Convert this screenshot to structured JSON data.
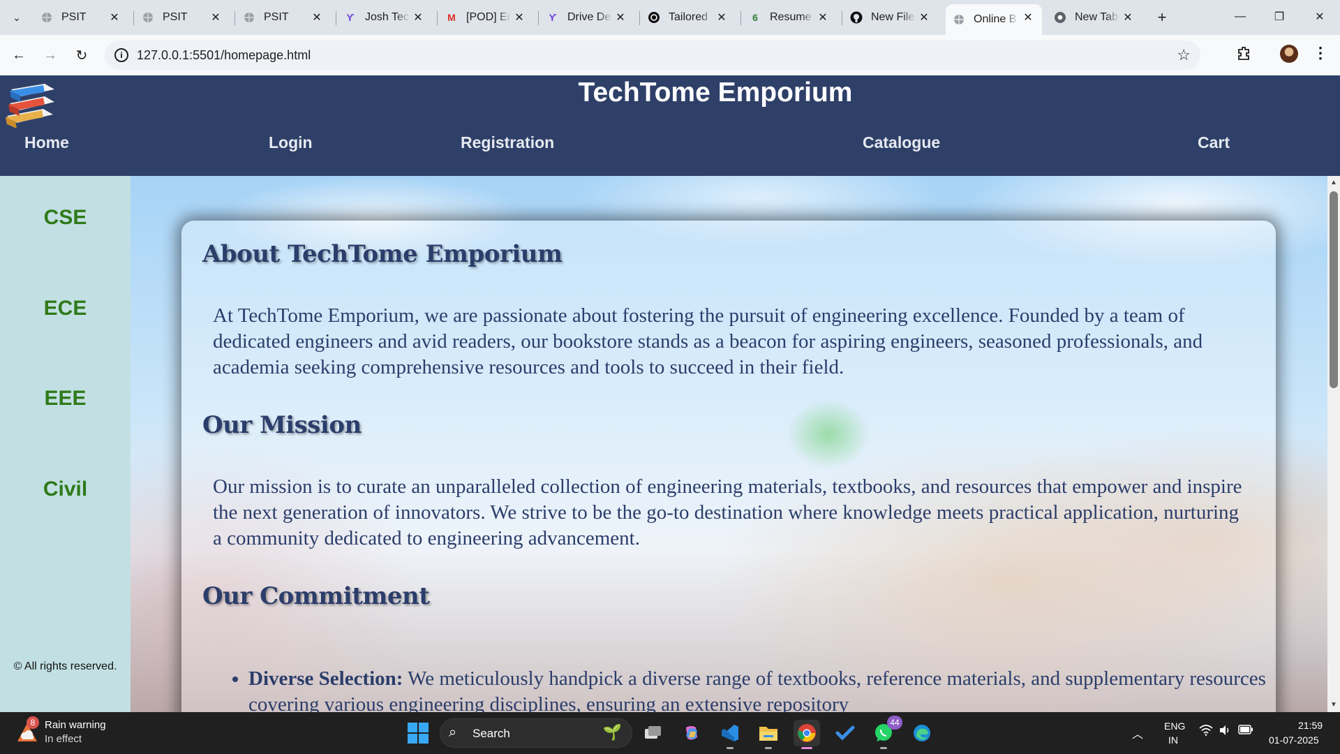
{
  "browser": {
    "tabs": [
      {
        "title": "PSIT",
        "favicon": "globe-icon"
      },
      {
        "title": "PSIT",
        "favicon": "globe-icon"
      },
      {
        "title": "PSIT",
        "favicon": "globe-icon"
      },
      {
        "title": "Josh Tec",
        "favicon": "josh-icon"
      },
      {
        "title": "[POD] Er",
        "favicon": "gmail-icon"
      },
      {
        "title": "Drive De",
        "favicon": "drive-icon"
      },
      {
        "title": "Tailored",
        "favicon": "openai-icon"
      },
      {
        "title": "Resume",
        "favicon": "resume-icon"
      },
      {
        "title": "New File",
        "favicon": "github-icon"
      },
      {
        "title": "Online B",
        "favicon": "globe-icon",
        "active": true
      },
      {
        "title": "New Tab",
        "favicon": "chrome-icon"
      }
    ],
    "url": "127.0.0.1:5501/homepage.html"
  },
  "site": {
    "title": "TechTome Emporium",
    "nav": [
      "Home",
      "Login",
      "Registration",
      "Catalogue",
      "Cart"
    ],
    "sidebar": [
      "CSE",
      "ECE",
      "EEE",
      "Civil"
    ],
    "copyright": "© All rights reserved."
  },
  "content": {
    "about_heading": "About TechTome Emporium",
    "about_text": "At TechTome Emporium, we are passionate about fostering the pursuit of engineering excellence. Founded by a team of dedicated engineers and avid readers, our bookstore stands as a beacon for aspiring engineers, seasoned professionals, and academia seeking comprehensive resources and tools to succeed in their field.",
    "mission_heading": "Our Mission",
    "mission_text": "Our mission is to curate an unparalleled collection of engineering materials, textbooks, and resources that empower and inspire the next generation of innovators. We strive to be the go-to destination where knowledge meets practical application, nurturing a community dedicated to engineering advancement.",
    "commitment_heading": "Our Commitment",
    "commitment_items": [
      {
        "label": "Diverse Selection:",
        "text": " We meticulously handpick a diverse range of textbooks, reference materials, and supplementary resources covering various engineering disciplines, ensuring an extensive repository"
      }
    ]
  },
  "taskbar": {
    "weather_badge": "8",
    "weather_title": "Rain warning",
    "weather_status": "In effect",
    "search_label": "Search",
    "whatsapp_badge": "44",
    "lang_line1": "ENG",
    "lang_line2": "IN",
    "time": "21:59",
    "date": "01-07-2025"
  },
  "colors": {
    "header_bg": "#2e4068",
    "sidebar_bg": "#c2e0e3",
    "sidebar_link": "#2f7a1a",
    "heading_text": "#2b3d6a"
  }
}
